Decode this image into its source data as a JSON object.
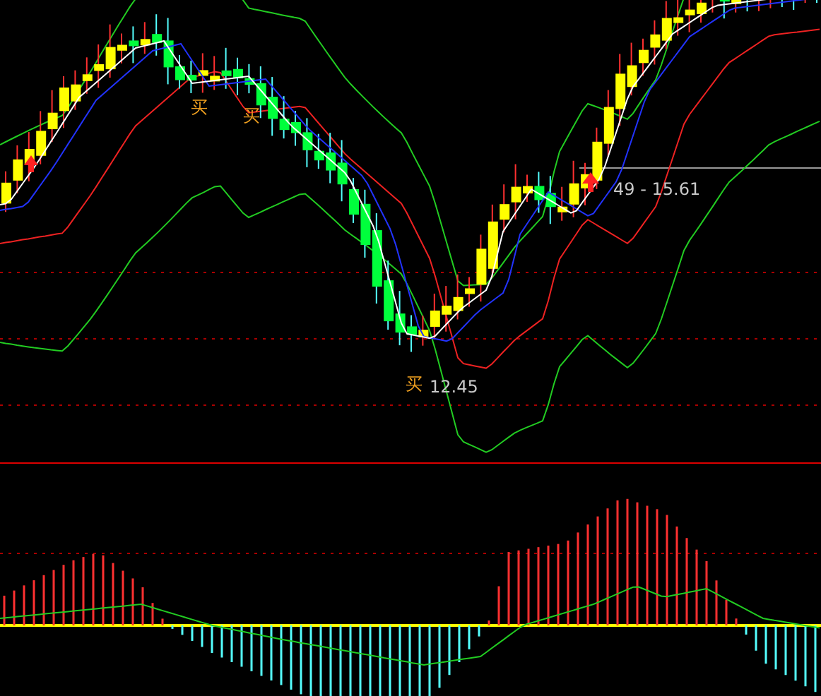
{
  "chart": {
    "buy_markers": [
      "买",
      "买",
      "买"
    ],
    "low_label": "12.45",
    "range_label": "49 - 15.61"
  }
}
